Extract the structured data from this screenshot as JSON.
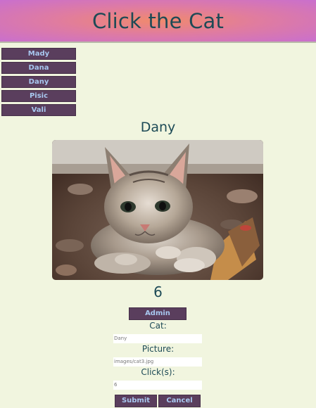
{
  "header": {
    "title": "Click the Cat"
  },
  "cat_list": [
    {
      "label": "Mady"
    },
    {
      "label": "Dana"
    },
    {
      "label": "Dany"
    },
    {
      "label": "Pisic"
    },
    {
      "label": "Vali"
    }
  ],
  "current_cat": {
    "name": "Dany",
    "clicks": "6",
    "image_icon": "kitten-photo"
  },
  "admin": {
    "button_label": "Admin",
    "cat_label": "Cat:",
    "cat_value": "Dany",
    "picture_label": "Picture:",
    "picture_value": "images/cat3.jpg",
    "clicks_label": "Click(s):",
    "clicks_value": "6",
    "submit_label": "Submit",
    "cancel_label": "Cancel"
  },
  "colors": {
    "background": "#f1f5df",
    "button": "#5a3e5d",
    "button_text": "#a8c8f0",
    "heading_text": "#1d4a56"
  }
}
